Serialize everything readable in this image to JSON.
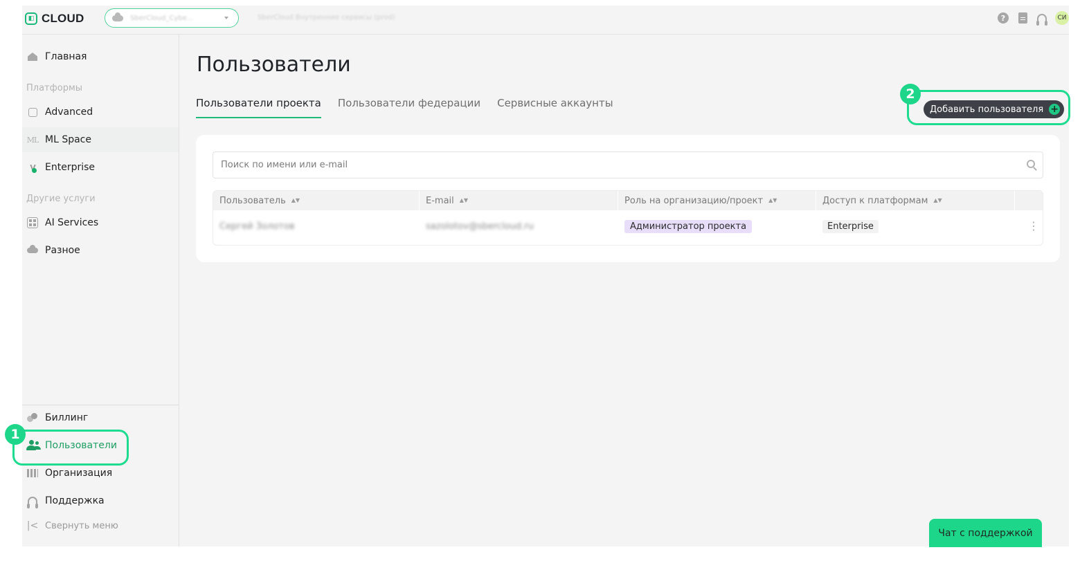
{
  "app": {
    "logo_text": "CLOUD"
  },
  "topbar": {
    "project_name": "SberCloud_Cybe...",
    "project_description": "SberCloud Внутренние сервисы (prod)",
    "avatar_initials": "СИ",
    "help_icon": "question-circle-icon",
    "docs_icon": "document-icon",
    "support_icon": "headset-icon"
  },
  "sidebar": {
    "home": "Главная",
    "section_platforms": "Платформы",
    "platforms": [
      "Advanced",
      "ML Space",
      "Enterprise"
    ],
    "ml_icon_text": "ML",
    "enterprise_icon_text": "V",
    "section_other": "Другие услуги",
    "other": [
      "AI Services",
      "Разное"
    ],
    "billing": "Биллинг",
    "users": "Пользователи",
    "organization": "Организация",
    "support": "Поддержка",
    "collapse": "Свернуть меню",
    "collapse_icon": "|<"
  },
  "main": {
    "title": "Пользователи",
    "tabs": [
      "Пользователи проекта",
      "Пользователи федерации",
      "Сервисные аккаунты"
    ],
    "active_tab": 0,
    "add_user_label": "Добавить пользователя",
    "search_placeholder": "Поиск по имени или e-mail",
    "table": {
      "headers": [
        "Пользователь",
        "E-mail",
        "Роль на организацию/проект",
        "Доступ к платформам"
      ],
      "rows": [
        {
          "user": "Сергей Золотов",
          "email": "sazolotov@sbercloud.ru",
          "role": "Администратор проекта",
          "platform": "Enterprise"
        }
      ]
    }
  },
  "annotations": {
    "marker_1": "1",
    "marker_2": "2"
  },
  "chat_button": "Чат с поддержкой",
  "colors": {
    "accent": "#1fb97a",
    "highlight": "#1edc8f",
    "button_dark": "#3d4147",
    "role_badge": "#e9defa"
  }
}
